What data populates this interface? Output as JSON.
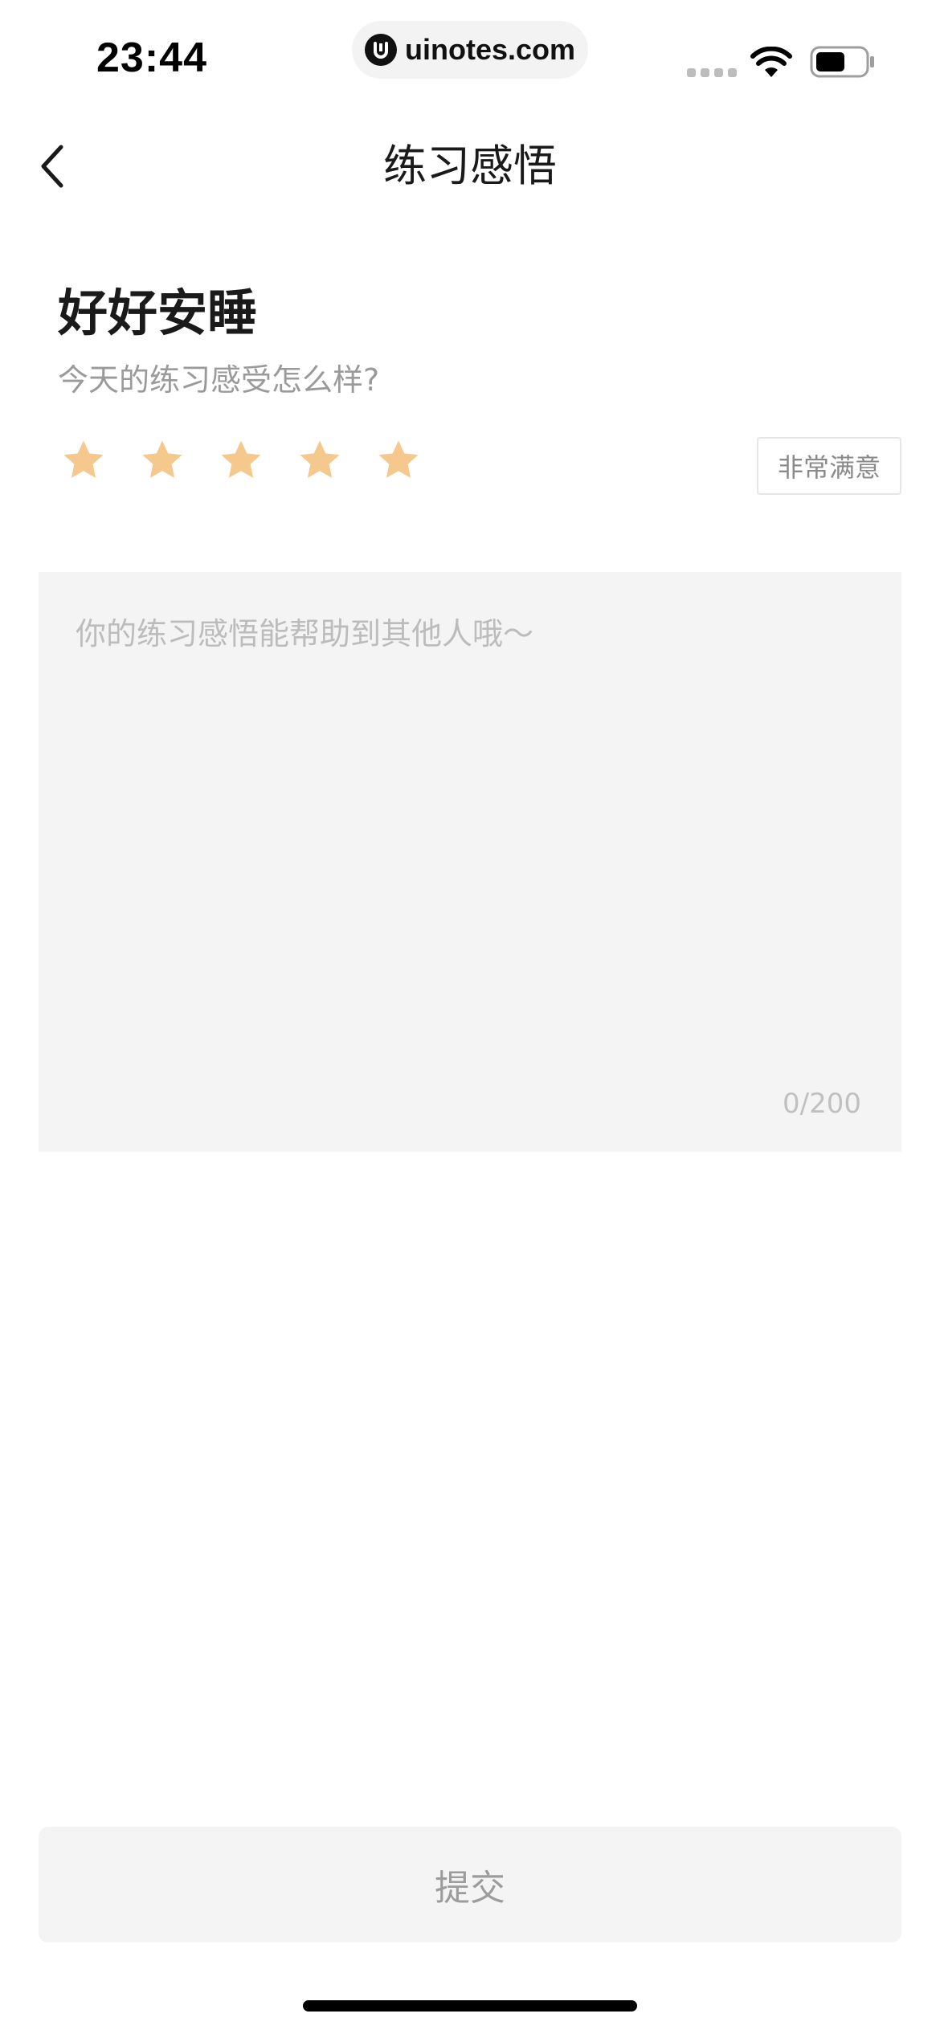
{
  "status_bar": {
    "time": "23:44",
    "url": "uinotes.com",
    "battery_level": 0.6
  },
  "nav": {
    "title": "练习感悟",
    "back_icon": "chevron-left-icon"
  },
  "course": {
    "title": "好好安睡",
    "question": "今天的练习感受怎么样?"
  },
  "rating": {
    "stars_filled": 5,
    "stars_total": 5,
    "star_color": "#F5C98E",
    "label": "非常满意"
  },
  "comment": {
    "placeholder": "你的练习感悟能帮助到其他人哦～",
    "value": "",
    "counter": "0/200"
  },
  "submit": {
    "label": "提交"
  }
}
